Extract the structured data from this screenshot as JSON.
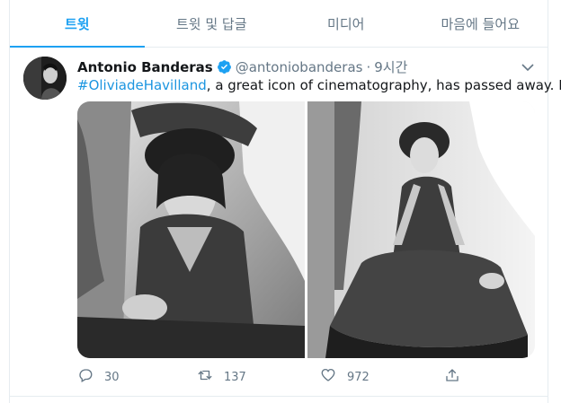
{
  "tabs": [
    {
      "label": "트윗",
      "active": true
    },
    {
      "label": "트윗 및 답글",
      "active": false
    },
    {
      "label": "미디어",
      "active": false
    },
    {
      "label": "마음에 들어요",
      "active": false
    }
  ],
  "tweet": {
    "author_name": "Antonio Banderas",
    "handle": "@antoniobanderas",
    "separator": "·",
    "time": "9시간",
    "hashtag": "#OliviadeHavilland",
    "text": ", a great icon of cinematography, has passed away. RIP",
    "replies": "30",
    "retweets": "137",
    "likes": "972"
  },
  "icons": {
    "verified": "verified-badge-icon",
    "caret": "chevron-down-icon",
    "reply": "reply-icon",
    "retweet": "retweet-icon",
    "like": "heart-icon",
    "share": "share-icon"
  },
  "colors": {
    "accent": "#1da1f2",
    "link": "#1b95e0",
    "muted": "#657786",
    "border": "#e6ecf0"
  }
}
